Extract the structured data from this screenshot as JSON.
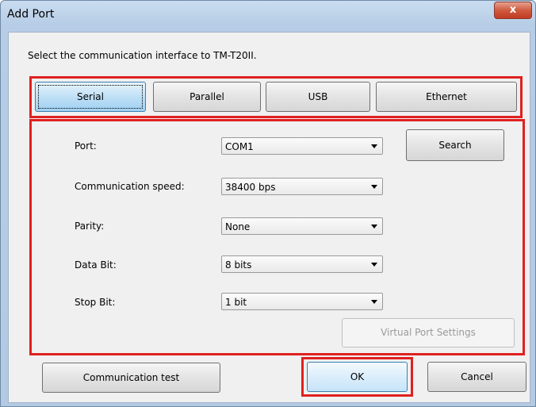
{
  "window": {
    "title": "Add Port",
    "close_label": "x"
  },
  "instruction": "Select the communication interface to TM-T20II.",
  "interface_tabs": [
    {
      "label": "Serial",
      "selected": true
    },
    {
      "label": "Parallel"
    },
    {
      "label": "USB"
    },
    {
      "label": "Ethernet"
    }
  ],
  "fields": {
    "port": {
      "label": "Port:",
      "value": "COM1"
    },
    "speed": {
      "label": "Communication speed:",
      "value": "38400 bps"
    },
    "parity": {
      "label": "Parity:",
      "value": "None"
    },
    "data_bit": {
      "label": "Data Bit:",
      "value": "8 bits"
    },
    "stop_bit": {
      "label": "Stop Bit:",
      "value": "1 bit"
    }
  },
  "buttons": {
    "search": "Search",
    "virtual_port_settings": "Virtual Port Settings",
    "communication_test": "Communication test",
    "ok": "OK",
    "cancel": "Cancel"
  },
  "colors": {
    "highlight": "#e02020",
    "title_bar": "#b4cae3"
  }
}
